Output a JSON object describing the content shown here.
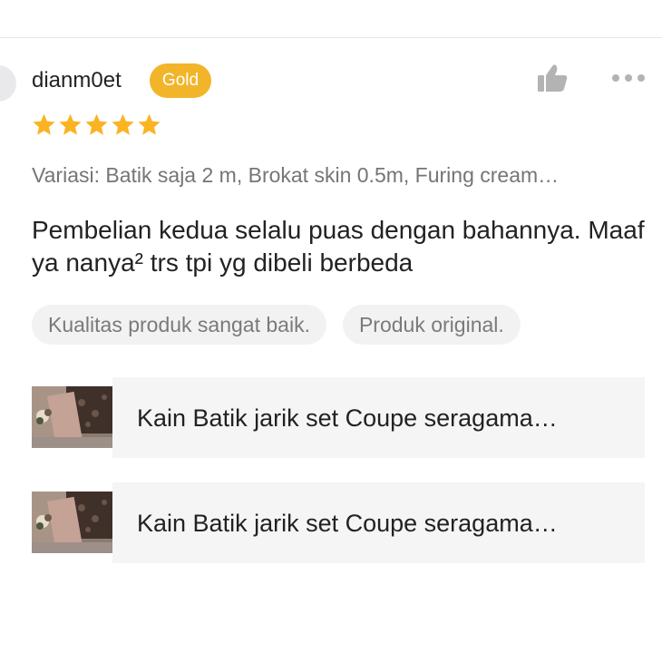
{
  "review": {
    "username": "dianm0et",
    "badge": "Gold",
    "rating": 5,
    "variation": "Variasi: Batik saja 2 m, Brokat skin 0.5m, Furing cream…",
    "text": "Pembelian kedua selalu puas dengan bahannya. Maaf ya nanya² trs tpi yg dibeli berbeda",
    "tags": [
      "Kualitas produk sangat baik.",
      "Produk original."
    ],
    "products": [
      {
        "name": "Kain Batik jarik set Coupe seragama…"
      },
      {
        "name": "Kain Batik jarik set Coupe seragama…"
      }
    ]
  },
  "icons": {
    "like": "thumbs-up-icon",
    "more": "more-dots-icon",
    "star": "star-icon"
  },
  "colors": {
    "badge": "#f2b52a",
    "star": "#fbb321",
    "icon_gray": "#b3b3b3",
    "tag_bg": "#f2f2f2",
    "product_bg": "#f5f5f5"
  }
}
